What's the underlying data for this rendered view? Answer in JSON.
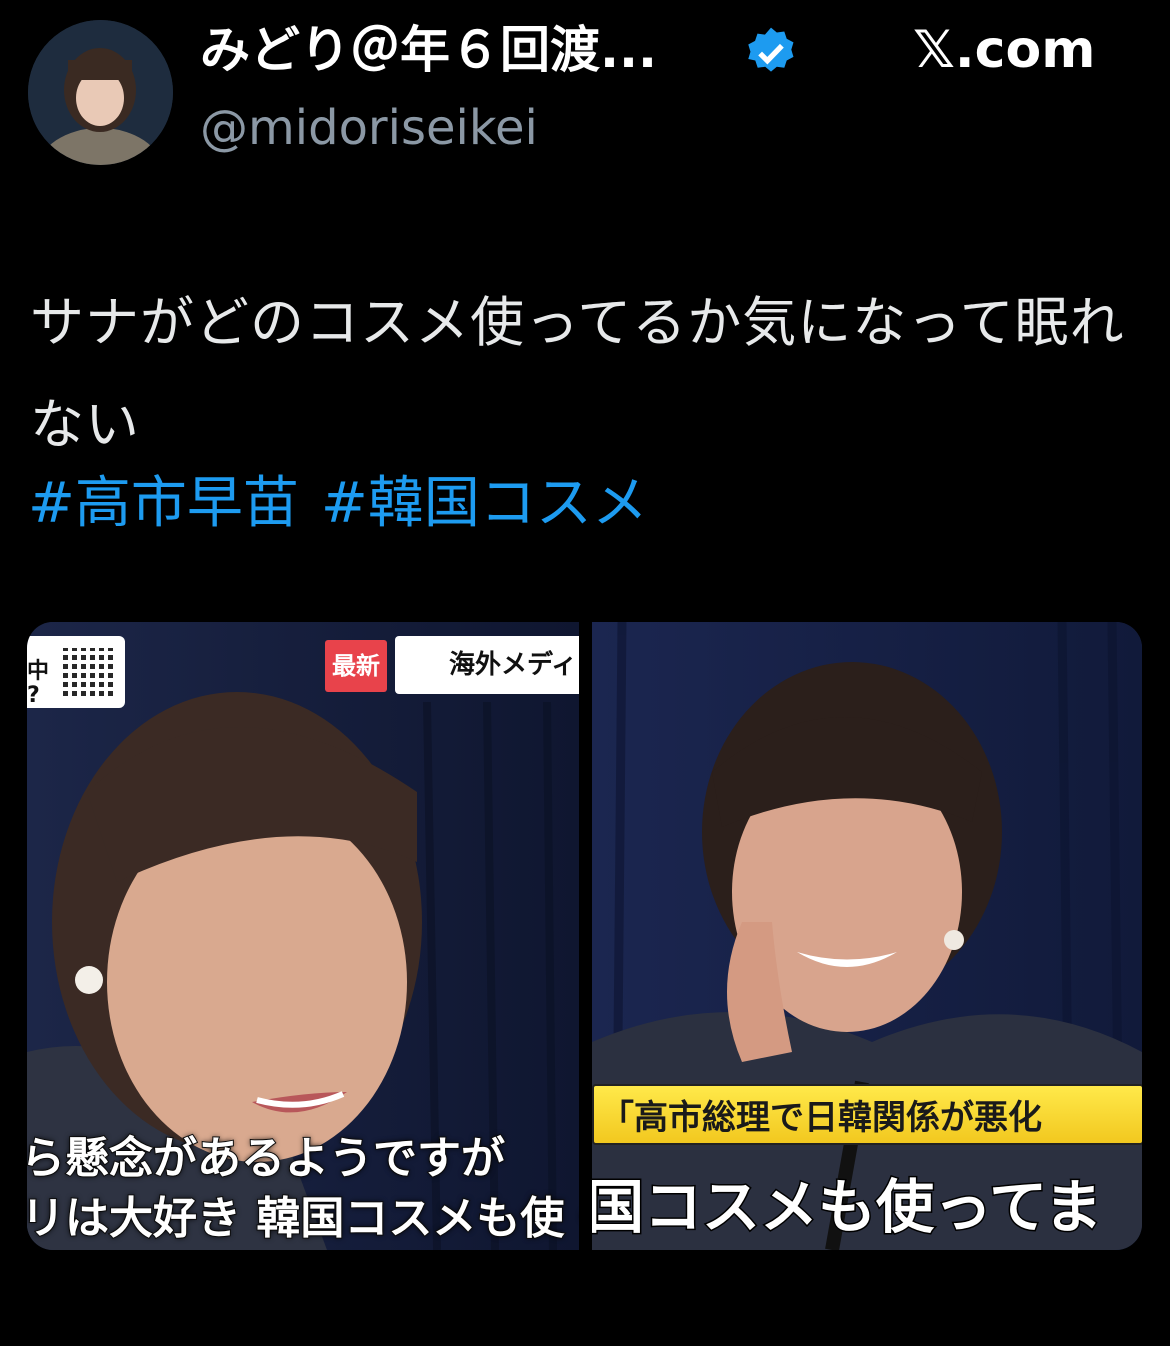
{
  "header": {
    "display_name": "みどり＠年６回渡...",
    "handle": "@midoriseikei",
    "site": "𝕏.com"
  },
  "tweet": {
    "text": "サナがどのコスメ使ってるか気になって眠れない",
    "hashtags": [
      "#高市早苗",
      "#韓国コスメ"
    ]
  },
  "media": {
    "left": {
      "badge_new": "最新",
      "badge_overseas": "海外メディ",
      "badge_qr_text": "中\n?",
      "caption_line1": "ら懸念があるようですが",
      "caption_line2": "リは大好き 韓国コスメも使・"
    },
    "right": {
      "caption_top": "「高市総理で日韓関係が悪化",
      "caption_bottom": "国コスメも使ってま"
    }
  },
  "colors": {
    "background": "#000000",
    "link": "#1d9bf0",
    "handle": "#8b98a5",
    "verified": "#1d9bf0"
  }
}
